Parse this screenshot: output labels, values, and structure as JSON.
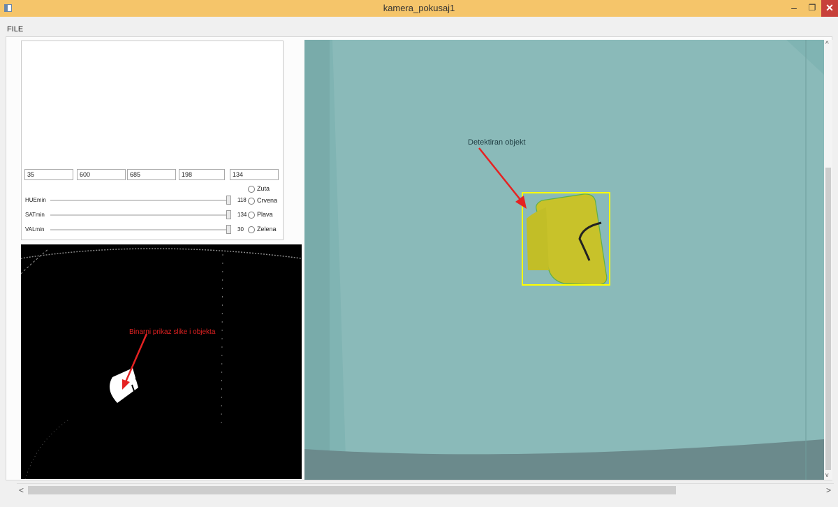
{
  "window": {
    "title": "kamera_pokusaj1",
    "minimize_label": "–",
    "maximize_label": "❐",
    "close_label": "✕"
  },
  "menu": {
    "file_label": "FILE"
  },
  "fields": [
    "35",
    "600",
    "685",
    "198",
    "134"
  ],
  "sliders": [
    {
      "label": "HUEmin",
      "value": "118",
      "level": 1.0
    },
    {
      "label": "SATmin",
      "value": "134",
      "level": 1.0
    },
    {
      "label": "VALmin",
      "value": "30",
      "level": 1.0
    }
  ],
  "colors_options": [
    "Zuta",
    "Crvena",
    "Plava",
    "Zelena"
  ],
  "binary_view": {
    "annotation": "Binarni prikaz slike i objekta"
  },
  "camera_view": {
    "annotation": "Detektiran objekt"
  },
  "scroll": {
    "left_arrow": "<",
    "right_arrow": ">",
    "up_arrow": "^",
    "down_arrow": "v"
  },
  "theme": {
    "titlebar": "#f5c56a",
    "close_button": "#c7403a",
    "bbox": "#ffff00",
    "arrow": "#e52222"
  }
}
